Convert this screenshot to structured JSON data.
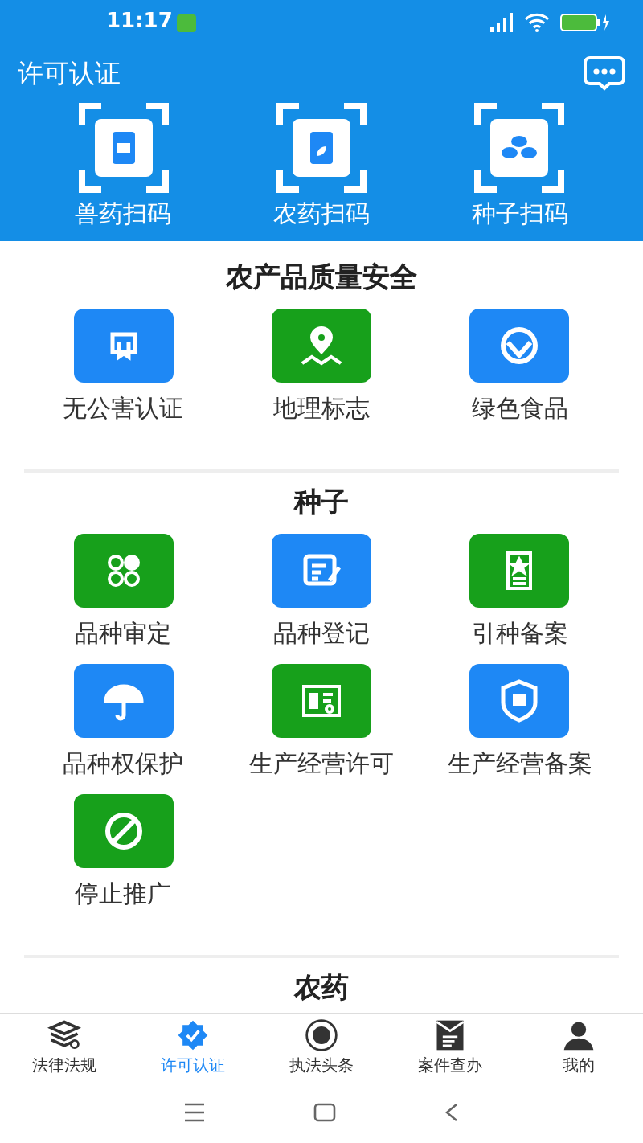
{
  "status_bar": {
    "time": "11:17"
  },
  "header": {
    "title": "许可认证"
  },
  "scan_buttons": [
    {
      "label": "兽药扫码"
    },
    {
      "label": "农药扫码"
    },
    {
      "label": "种子扫码"
    }
  ],
  "sections": [
    {
      "title": "农产品质量安全",
      "items": [
        {
          "label": "无公害认证",
          "color": "#1e88f5"
        },
        {
          "label": "地理标志",
          "color": "#17a01b"
        },
        {
          "label": "绿色食品",
          "color": "#1e88f5"
        }
      ]
    },
    {
      "title": "种子",
      "items": [
        {
          "label": "品种审定",
          "color": "#17a01b"
        },
        {
          "label": "品种登记",
          "color": "#1e88f5"
        },
        {
          "label": "引种备案",
          "color": "#17a01b"
        },
        {
          "label": "品种权保护",
          "color": "#1e88f5"
        },
        {
          "label": "生产经营许可",
          "color": "#17a01b"
        },
        {
          "label": "生产经营备案",
          "color": "#1e88f5"
        },
        {
          "label": "停止推广",
          "color": "#17a01b"
        }
      ]
    },
    {
      "title": "农药"
    }
  ],
  "tabs": [
    {
      "label": "法律法规",
      "selected": false
    },
    {
      "label": "许可认证",
      "selected": true
    },
    {
      "label": "执法头条",
      "selected": false
    },
    {
      "label": "案件查办",
      "selected": false
    },
    {
      "label": "我的",
      "selected": false
    }
  ]
}
